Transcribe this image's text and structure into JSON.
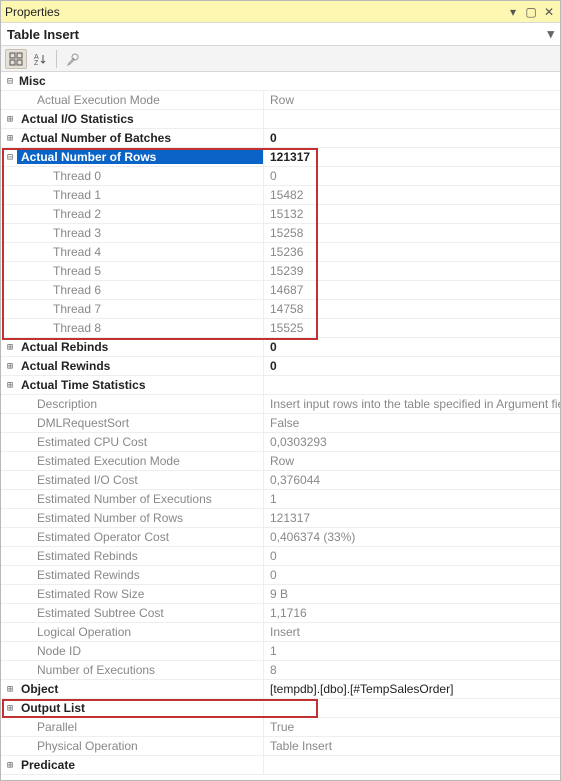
{
  "window": {
    "title": "Properties",
    "subtitle": "Table Insert"
  },
  "category": {
    "misc": "Misc"
  },
  "rows": {
    "actualExecutionMode": {
      "label": "Actual Execution Mode",
      "value": "Row"
    },
    "actualIOStats": {
      "label": "Actual I/O Statistics",
      "value": ""
    },
    "actualNumBatches": {
      "label": "Actual Number of Batches",
      "value": "0"
    },
    "actualNumRows": {
      "label": "Actual Number of Rows",
      "value": "121317"
    },
    "threads": [
      {
        "label": "Thread 0",
        "value": "0"
      },
      {
        "label": "Thread 1",
        "value": "15482"
      },
      {
        "label": "Thread 2",
        "value": "15132"
      },
      {
        "label": "Thread 3",
        "value": "15258"
      },
      {
        "label": "Thread 4",
        "value": "15236"
      },
      {
        "label": "Thread 5",
        "value": "15239"
      },
      {
        "label": "Thread 6",
        "value": "14687"
      },
      {
        "label": "Thread 7",
        "value": "14758"
      },
      {
        "label": "Thread 8",
        "value": "15525"
      }
    ],
    "actualRebinds": {
      "label": "Actual Rebinds",
      "value": "0"
    },
    "actualRewinds": {
      "label": "Actual Rewinds",
      "value": "0"
    },
    "actualTimeStats": {
      "label": "Actual Time Statistics",
      "value": ""
    },
    "description": {
      "label": "Description",
      "value": "Insert input rows into the table specified in Argument field."
    },
    "dmlRequestSort": {
      "label": "DMLRequestSort",
      "value": "False"
    },
    "estCpuCost": {
      "label": "Estimated CPU Cost",
      "value": "0,0303293"
    },
    "estExecMode": {
      "label": "Estimated Execution Mode",
      "value": "Row"
    },
    "estIoCost": {
      "label": "Estimated I/O Cost",
      "value": "0,376044"
    },
    "estNumExec": {
      "label": "Estimated Number of Executions",
      "value": "1"
    },
    "estNumRows": {
      "label": "Estimated Number of Rows",
      "value": "121317"
    },
    "estOpCost": {
      "label": "Estimated Operator Cost",
      "value": "0,406374 (33%)"
    },
    "estRebinds": {
      "label": "Estimated Rebinds",
      "value": "0"
    },
    "estRewinds": {
      "label": "Estimated Rewinds",
      "value": "0"
    },
    "estRowSize": {
      "label": "Estimated Row Size",
      "value": "9 B"
    },
    "estSubtreeCost": {
      "label": "Estimated Subtree Cost",
      "value": "1,1716"
    },
    "logicalOp": {
      "label": "Logical Operation",
      "value": "Insert"
    },
    "nodeId": {
      "label": "Node ID",
      "value": "1"
    },
    "numExecutions": {
      "label": "Number of Executions",
      "value": "8"
    },
    "object": {
      "label": "Object",
      "value": "[tempdb].[dbo].[#TempSalesOrder]"
    },
    "outputList": {
      "label": "Output List",
      "value": ""
    },
    "parallel": {
      "label": "Parallel",
      "value": "True"
    },
    "physicalOp": {
      "label": "Physical Operation",
      "value": "Table Insert"
    },
    "predicate": {
      "label": "Predicate",
      "value": ""
    }
  }
}
